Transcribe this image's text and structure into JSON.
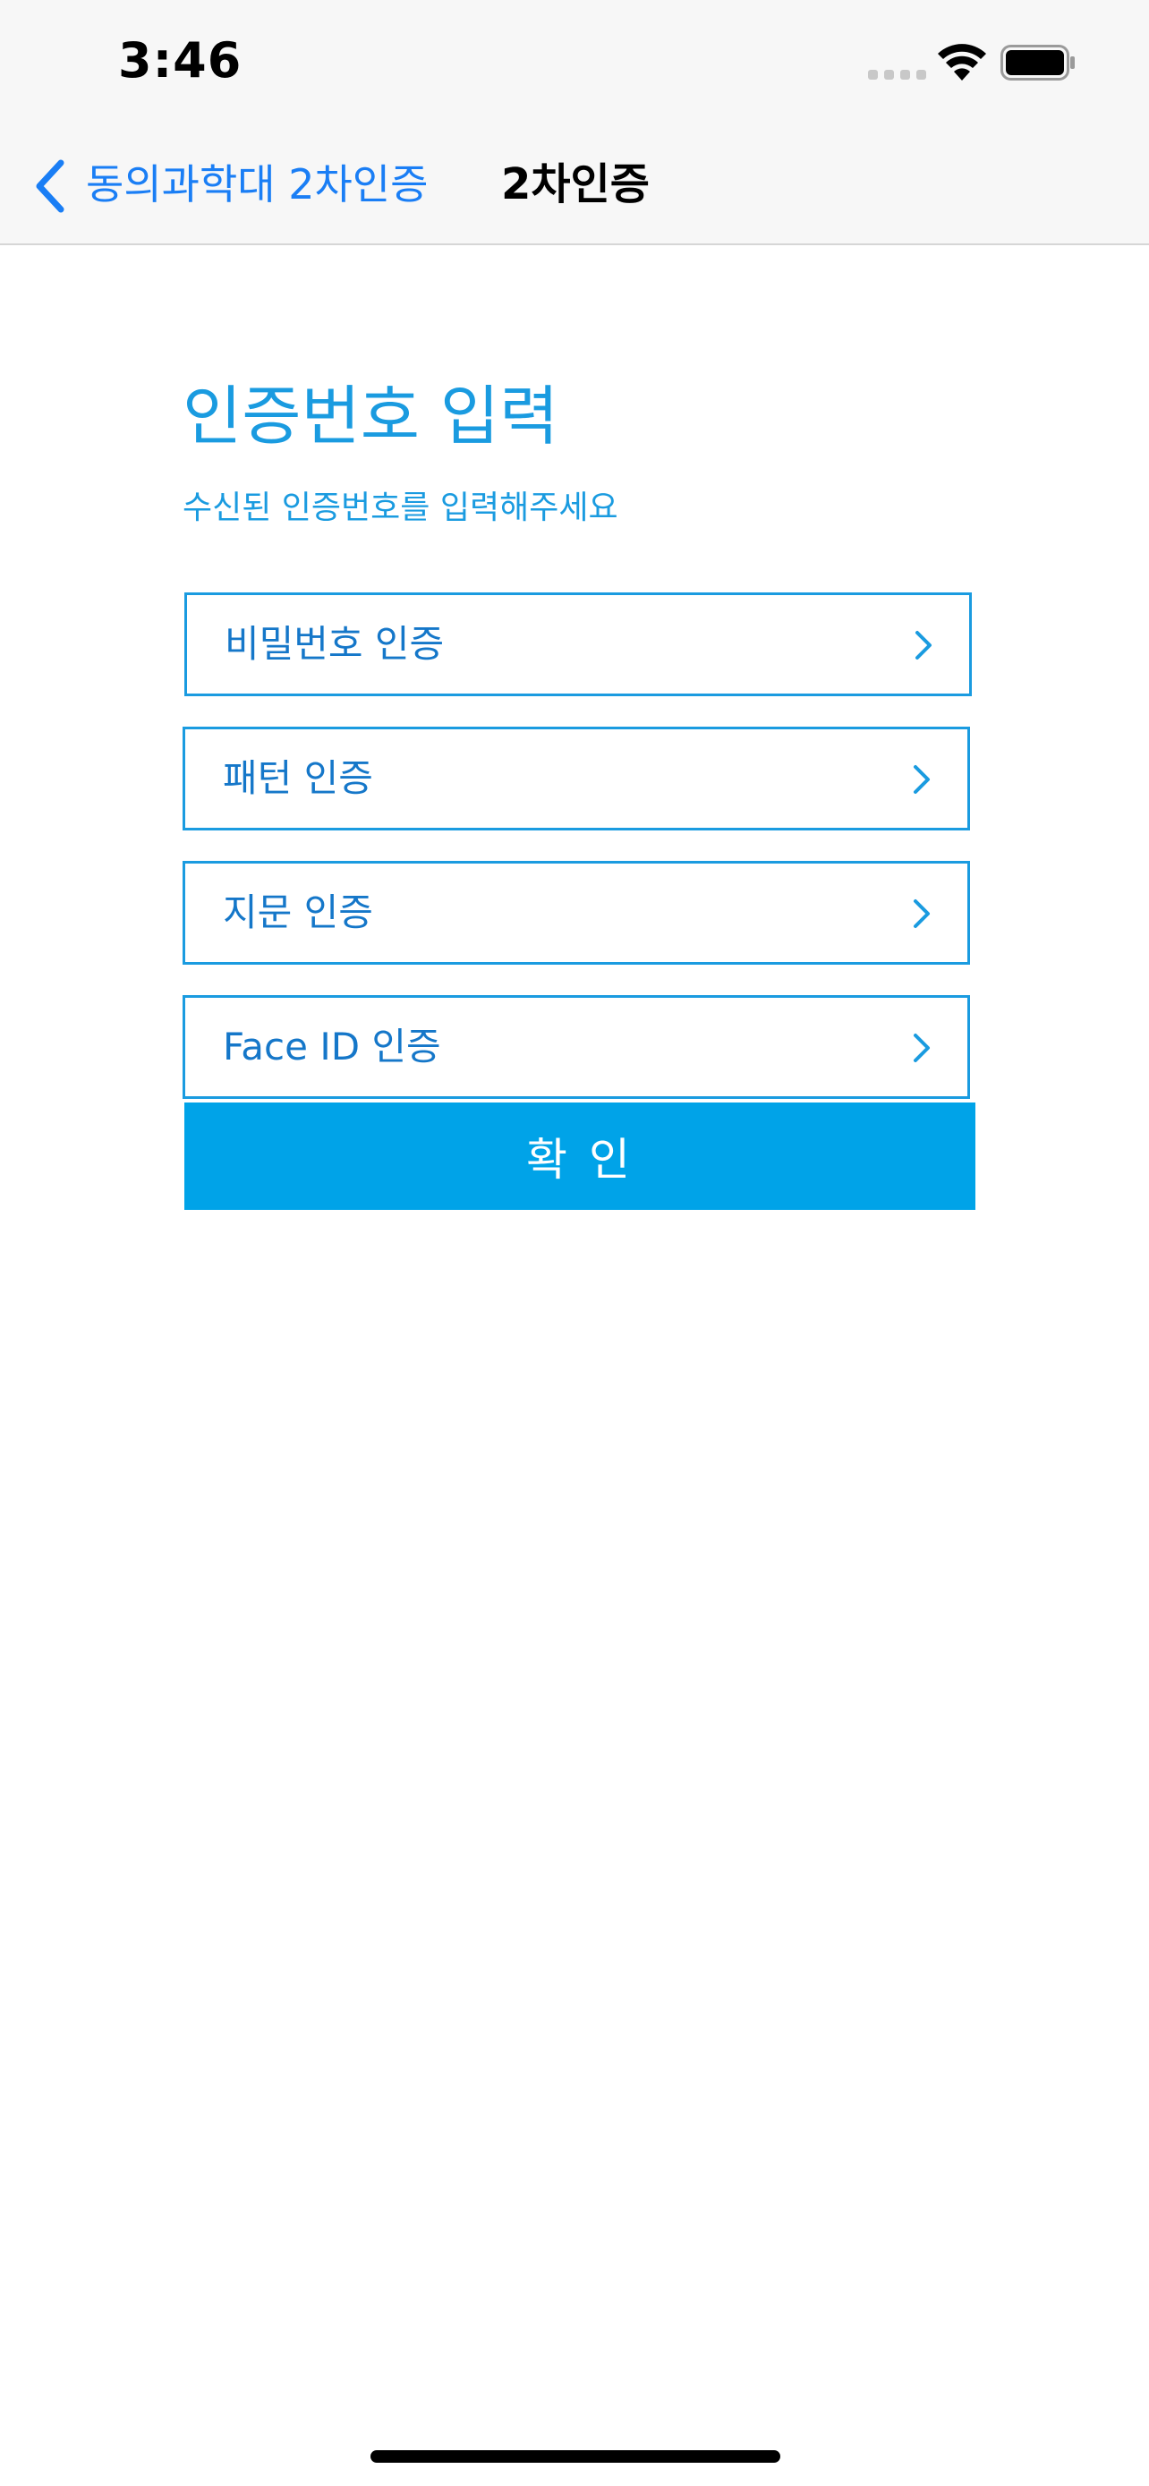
{
  "status_bar": {
    "time": "3:46"
  },
  "nav": {
    "back_label": "동의과학대 2차인증",
    "title": "2차인증"
  },
  "main": {
    "title": "인증번호 입력",
    "subtitle": "수신된 인증번호를 입력해주세요",
    "options": [
      {
        "label": "비밀번호 인증"
      },
      {
        "label": "패턴 인증"
      },
      {
        "label": "지문 인증"
      },
      {
        "label": "Face ID 인증"
      }
    ],
    "confirm_label": "확 인"
  },
  "colors": {
    "accent": "#1a9be0",
    "button": "#00a3e8",
    "link": "#1a7ef5"
  },
  "icons": {
    "back": "chevron-left-icon",
    "option": "chevron-right-icon",
    "wifi": "wifi-icon",
    "battery": "battery-icon"
  }
}
